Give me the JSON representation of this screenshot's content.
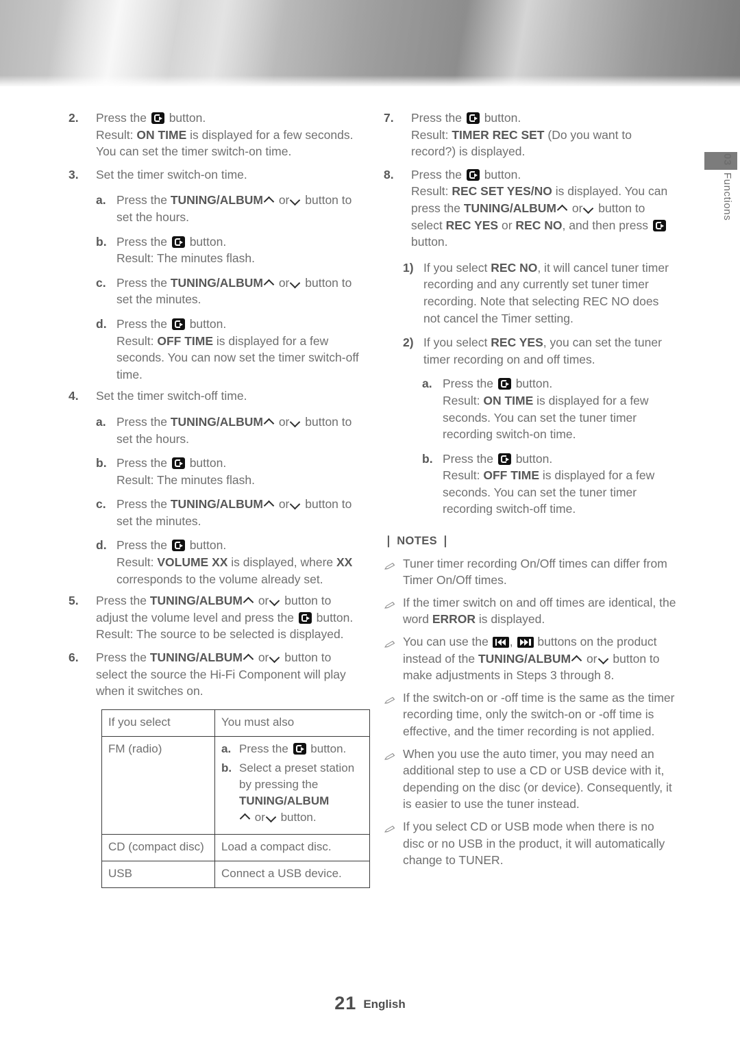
{
  "banner": {
    "name": "metallic-header-band"
  },
  "side_tab": {
    "chapter_number": "03",
    "chapter_title": "Functions"
  },
  "footer": {
    "page_number": "21",
    "language": "English"
  },
  "icons": {
    "enter_button": "enter-button-icon",
    "chevron_up": "chevron-up-icon",
    "chevron_down": "chevron-down-icon",
    "prev_track": "previous-track-icon",
    "next_track": "next-track-icon",
    "note_bullet": "pencil-icon"
  },
  "labels": {
    "press_the": "Press the",
    "button": "button",
    "result": "Result:",
    "or": "or",
    "the": "the"
  },
  "left_column": {
    "step2": {
      "marker": "2.",
      "line1_pre": "Press the",
      "line1_post": "button.",
      "result_label": "Result:",
      "result_bold": "ON TIME",
      "result_rest": "is displayed for a few seconds. You can set the timer switch-on time."
    },
    "step3": {
      "marker": "3.",
      "text": "Set the timer switch-on time.",
      "a": {
        "marker": "a.",
        "pre": "Press the",
        "bold": "TUNING/ALBUM",
        "mid": "or",
        "post": "button to set the hours."
      },
      "b": {
        "marker": "b.",
        "pre": "Press the",
        "post": "button.",
        "result": "Result: The minutes flash."
      },
      "c": {
        "marker": "c.",
        "pre": "Press the",
        "bold": "TUNING/ALBUM",
        "mid": "or",
        "post": "button to set the minutes."
      },
      "d": {
        "marker": "d.",
        "pre": "Press the",
        "post": "button.",
        "result_label": "Result:",
        "result_bold": "OFF TIME",
        "result_rest": "is displayed for a few seconds. You can now set the timer switch-off time."
      }
    },
    "step4": {
      "marker": "4.",
      "text": "Set the timer switch-off time.",
      "a": {
        "marker": "a.",
        "pre": "Press the",
        "bold": "TUNING/ALBUM",
        "mid": "or",
        "post": "button to set the hours."
      },
      "b": {
        "marker": "b.",
        "pre": "Press the",
        "post": "button.",
        "result": "Result: The minutes flash."
      },
      "c": {
        "marker": "c.",
        "pre": "Press the",
        "bold": "TUNING/ALBUM",
        "mid": "or",
        "post": "button to set the minutes."
      },
      "d": {
        "marker": "d.",
        "pre": "Press the",
        "post": "button.",
        "result_label": "Result:",
        "result_bold": "VOLUME XX",
        "result_mid": "is displayed, where",
        "result_bold2": "XX",
        "result_rest": "corresponds to the volume already set."
      }
    },
    "step5": {
      "marker": "5.",
      "pre": "Press the",
      "bold": "TUNING/ALBUM",
      "mid": "or",
      "post": "button to adjust the volume level and press the",
      "post2": "button.",
      "result": "Result: The source to be selected is displayed."
    },
    "step6": {
      "marker": "6.",
      "pre": "Press the",
      "bold": "TUNING/ALBUM",
      "mid": "or",
      "post": "button to select the source the Hi-Fi Component will play when it switches on."
    },
    "table": {
      "headers": [
        "If you select",
        "You must also"
      ],
      "rows": [
        {
          "select": "FM (radio)",
          "actions": [
            {
              "marker": "a.",
              "pre": "Press the",
              "post": "button."
            },
            {
              "marker": "b.",
              "pre": "Select a preset station by pressing the",
              "bold": "TUNING/ALBUM",
              "mid": "or",
              "post": "button."
            }
          ]
        },
        {
          "select": "CD (compact disc)",
          "action_text": "Load a compact disc."
        },
        {
          "select": "USB",
          "action_text": "Connect a USB device."
        }
      ]
    }
  },
  "right_column": {
    "step7": {
      "marker": "7.",
      "pre": "Press the",
      "post": "button.",
      "result_label": "Result:",
      "result_bold": "TIMER REC SET",
      "result_rest": "(Do you want to record?) is displayed."
    },
    "step8": {
      "marker": "8.",
      "pre": "Press the",
      "post": "button.",
      "result_label": "Result:",
      "result_bold": "REC SET YES/NO",
      "result_p1": "is displayed. You can press the",
      "result_bold2": "TUNING/ALBUM",
      "result_mid": "or",
      "result_p2": "button to select",
      "result_bold3": "REC YES",
      "result_or": "or",
      "result_bold4": "REC NO",
      "result_p3": ", and then press",
      "result_p4": "button."
    },
    "sub1": {
      "marker": "1)",
      "pre": "If you select",
      "bold": "REC NO",
      "post": ", it will cancel tuner timer recording and any currently set tuner timer recording. Note that selecting REC NO does not cancel the Timer setting."
    },
    "sub2": {
      "marker": "2)",
      "pre": "If you select",
      "bold": "REC YES",
      "post": ", you can set the tuner timer recording on and off times.",
      "a": {
        "marker": "a.",
        "pre": "Press the",
        "post": "button.",
        "result_label": "Result:",
        "result_bold": "ON TIME",
        "result_rest": "is displayed for a few seconds. You can set the tuner timer recording switch-on time."
      },
      "b": {
        "marker": "b.",
        "pre": "Press the",
        "post": "button.",
        "result_label": "Result:",
        "result_bold": "OFF TIME",
        "result_rest": "is displayed for a few seconds. You can set the tuner timer recording switch-off time."
      }
    },
    "notes_title": "❘ NOTES ❘",
    "notes": [
      {
        "text": "Tuner timer recording On/Off times can differ from Timer On/Off times."
      },
      {
        "pre": "If the timer switch on and off times are identical, the word",
        "bold": "ERROR",
        "post": "is displayed."
      },
      {
        "pre": "You can use the",
        "mid": "buttons on the product instead of the",
        "bold": "TUNING/ALBUM",
        "mid2": "or",
        "post": "button to make adjustments in Steps 3 through 8."
      },
      {
        "text": "If the switch-on or -off time is the same as the timer recording time, only the switch-on or -off time is effective, and the timer recording is not applied."
      },
      {
        "text": "When you use the auto timer, you may need an additional step to use a CD or USB device with it, depending on the disc (or device). Consequently, it is easier to use the tuner instead."
      },
      {
        "text": "If you select CD or USB mode when there is no disc or no USB in the product, it will automatically change to TUNER."
      }
    ]
  }
}
